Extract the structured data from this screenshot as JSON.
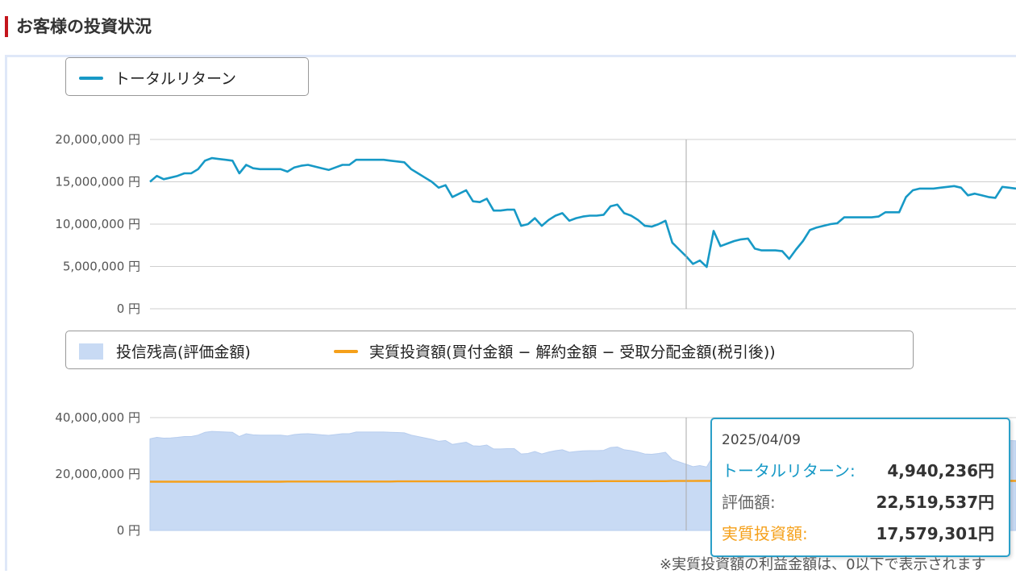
{
  "header": {
    "title": "お客様の投資状況"
  },
  "legend_top": {
    "total_return_label": "トータルリターン"
  },
  "legend_bottom": {
    "balance_label": "投信残高(評価金額)",
    "invested_label": "実質投資額(買付金額 − 解約金額 − 受取分配金額(税引後))"
  },
  "colors": {
    "accent": "#c4151c",
    "total_return_line": "#1799c6",
    "balance_area": "#c8daf4",
    "invested_line": "#f5a01a",
    "tooltip_border": "#2a9fc8"
  },
  "tooltip": {
    "date": "2025/04/09",
    "total_return_label": "トータルリターン:",
    "total_return_value": "4,940,236円",
    "valuation_label": "評価額:",
    "valuation_value": "22,519,537円",
    "invested_label": "実質投資額:",
    "invested_value": "17,579,301円"
  },
  "footnote": "※実質投資額の利益金額は、0以下で表示されます",
  "chart_data": [
    {
      "type": "line",
      "series": [
        {
          "name": "トータルリターン",
          "values": [
            15000000,
            15700000,
            15300000,
            15500000,
            15700000,
            16000000,
            16000000,
            16500000,
            17500000,
            17800000,
            17700000,
            17600000,
            17500000,
            16000000,
            17000000,
            16600000,
            16500000,
            16500000,
            16500000,
            16500000,
            16200000,
            16700000,
            16900000,
            17000000,
            16800000,
            16600000,
            16400000,
            16700000,
            17000000,
            17000000,
            17600000,
            17600000,
            17600000,
            17600000,
            17600000,
            17500000,
            17400000,
            17300000,
            16500000,
            16000000,
            15500000,
            15000000,
            14300000,
            14600000,
            13200000,
            13600000,
            14000000,
            12700000,
            12600000,
            13000000,
            11600000,
            11600000,
            11700000,
            11700000,
            9800000,
            10000000,
            10700000,
            9800000,
            10500000,
            11000000,
            11300000,
            10400000,
            10700000,
            10900000,
            11000000,
            11000000,
            11100000,
            12100000,
            12300000,
            11300000,
            11000000,
            10500000,
            9800000,
            9700000,
            10000000,
            10400000,
            7800000,
            7000000,
            6200000,
            5300000,
            5700000,
            4940236,
            9200000,
            7400000,
            7700000,
            8000000,
            8200000,
            8300000,
            7100000,
            6900000,
            6900000,
            6900000,
            6800000,
            5900000,
            7000000,
            8000000,
            9300000,
            9600000,
            9800000,
            10000000,
            10100000,
            10800000,
            10800000,
            10800000,
            10800000,
            10800000,
            10900000,
            11400000,
            11400000,
            11400000,
            13200000,
            14000000,
            14200000,
            14200000,
            14200000,
            14300000,
            14400000,
            14500000,
            14300000,
            13400000,
            13600000,
            13400000,
            13200000,
            13100000,
            14400000,
            14300000,
            14200000
          ]
        }
      ],
      "ylim": [
        0,
        20000000
      ],
      "ytick_labels": [
        "20,000,000 円",
        "15,000,000 円",
        "10,000,000 円",
        "5,000,000 円",
        "0 円"
      ],
      "grid": true,
      "legend": "top-left"
    },
    {
      "type": "area",
      "series": [
        {
          "name": "投信残高(評価金額)",
          "values": [
            32500000,
            33000000,
            32700000,
            32800000,
            33000000,
            33300000,
            33300000,
            33800000,
            34800000,
            35100000,
            35000000,
            34900000,
            34800000,
            33300000,
            34300000,
            33900000,
            33800000,
            33800000,
            33800000,
            33800000,
            33500000,
            34000000,
            34200000,
            34300000,
            34100000,
            33900000,
            33700000,
            34000000,
            34300000,
            34300000,
            34900000,
            34900000,
            34900000,
            34900000,
            34900000,
            34800000,
            34700000,
            34600000,
            33800000,
            33300000,
            32800000,
            32300000,
            31600000,
            31900000,
            30500000,
            30900000,
            31300000,
            30000000,
            29900000,
            30300000,
            28900000,
            28900000,
            29000000,
            29000000,
            27100000,
            27300000,
            28000000,
            27100000,
            27800000,
            28300000,
            28600000,
            27700000,
            28000000,
            28200000,
            28300000,
            28300000,
            28400000,
            29400000,
            29600000,
            28600000,
            28300000,
            27800000,
            27100000,
            27000000,
            27300000,
            27700000,
            25100000,
            24300000,
            23500000,
            22600000,
            23000000,
            22519537,
            26800000,
            25000000,
            25300000,
            25600000,
            25800000,
            25900000,
            24700000,
            24500000,
            24500000,
            24500000,
            24400000,
            23500000,
            24600000,
            25600000,
            26900000,
            27200000,
            27400000,
            27600000,
            27700000,
            28400000,
            28400000,
            28400000,
            28400000,
            28400000,
            28500000,
            29000000,
            29000000,
            29000000,
            30800000,
            31600000,
            31800000,
            31800000,
            31800000,
            31900000,
            32000000,
            32100000,
            31900000,
            31000000,
            31200000,
            31000000,
            30800000,
            30700000,
            32000000,
            31900000,
            31800000
          ]
        },
        {
          "name": "実質投資額(買付金額 − 解約金額 − 受取分配金額(税引後))",
          "values": [
            17300000,
            17300000,
            17300000,
            17300000,
            17300000,
            17300000,
            17300000,
            17300000,
            17300000,
            17300000,
            17300000,
            17300000,
            17300000,
            17300000,
            17300000,
            17300000,
            17300000,
            17300000,
            17300000,
            17300000,
            17350000,
            17350000,
            17350000,
            17350000,
            17350000,
            17350000,
            17350000,
            17350000,
            17350000,
            17350000,
            17350000,
            17350000,
            17350000,
            17350000,
            17350000,
            17350000,
            17400000,
            17400000,
            17400000,
            17400000,
            17400000,
            17400000,
            17400000,
            17400000,
            17400000,
            17400000,
            17400000,
            17400000,
            17400000,
            17400000,
            17450000,
            17450000,
            17450000,
            17450000,
            17450000,
            17450000,
            17450000,
            17450000,
            17450000,
            17450000,
            17450000,
            17450000,
            17450000,
            17450000,
            17450000,
            17500000,
            17500000,
            17500000,
            17500000,
            17500000,
            17500000,
            17500000,
            17500000,
            17500000,
            17500000,
            17500000,
            17550000,
            17550000,
            17550000,
            17550000,
            17570000,
            17579301,
            17579301,
            17579301,
            17579301,
            17579301,
            17579301,
            17579301,
            17579301,
            17579301,
            17579301,
            17579301,
            17579301,
            17579301,
            17579301,
            17579301,
            17579301,
            17579301,
            17579301,
            17579301,
            17579301,
            17579301,
            17579301,
            17579301,
            17579301,
            17579301,
            17579301,
            17579301,
            17579301,
            17579301,
            17579301,
            17579301,
            17579301,
            17579301,
            17579301,
            17579301,
            17579301,
            17579301,
            17579301,
            17579301,
            17579301,
            17579301,
            17579301,
            17579301,
            17579301,
            17579301,
            17579301
          ]
        }
      ],
      "ylim": [
        0,
        40000000
      ],
      "ytick_labels": [
        "40,000,000 円",
        "20,000,000 円",
        "0 円"
      ],
      "grid": true,
      "legend": "top-left"
    }
  ]
}
